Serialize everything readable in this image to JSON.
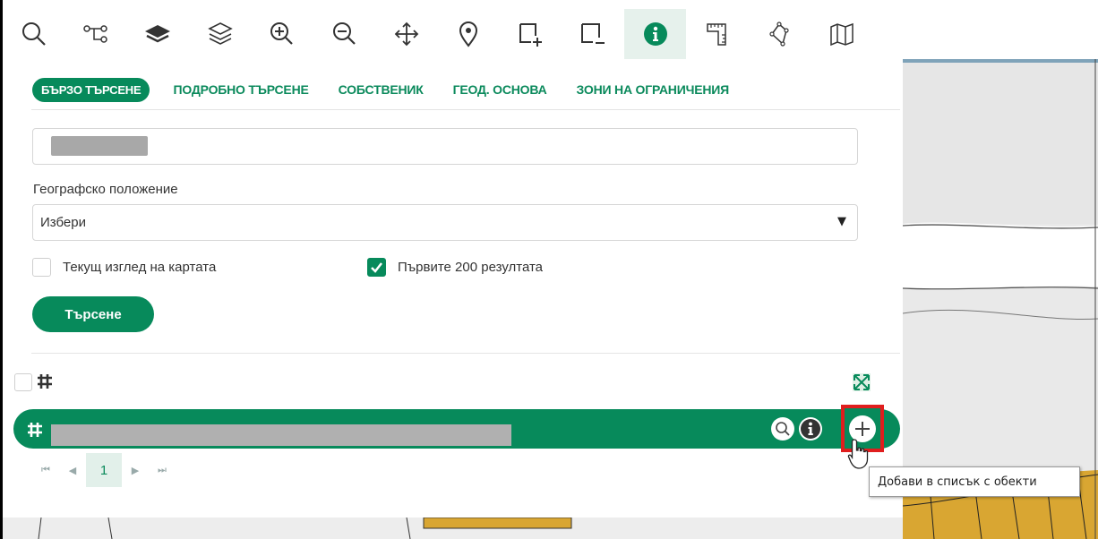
{
  "toolbar": {
    "tools": [
      {
        "icon": "search-icon"
      },
      {
        "icon": "route-icon"
      },
      {
        "icon": "layers-icon"
      },
      {
        "icon": "layers-outline-icon"
      },
      {
        "icon": "zoom-in-icon"
      },
      {
        "icon": "zoom-out-icon"
      },
      {
        "icon": "pan-icon"
      },
      {
        "icon": "location-pin-icon"
      },
      {
        "icon": "select-area-add-icon"
      },
      {
        "icon": "select-area-remove-icon"
      },
      {
        "icon": "info-icon",
        "active": true
      },
      {
        "icon": "measure-icon"
      },
      {
        "icon": "polygon-icon"
      },
      {
        "icon": "map-icon"
      }
    ]
  },
  "tabs": [
    {
      "label": "БЪРЗО ТЪРСЕНЕ",
      "active": true
    },
    {
      "label": "ПОДРОБНО ТЪРСЕНЕ"
    },
    {
      "label": "СОБСТВЕНИК"
    },
    {
      "label": "ГЕОД. ОСНОВА"
    },
    {
      "label": "ЗОНИ НА ОГРАНИЧЕНИЯ"
    }
  ],
  "form": {
    "geo_label": "Географско положение",
    "geo_value": "Избери",
    "current_view_label": "Текущ изглед на картата",
    "current_view_checked": false,
    "first200_label": "Първите 200 резултата",
    "first200_checked": true,
    "search_button": "Търсене"
  },
  "pager": {
    "current_page": "1"
  },
  "tooltip": "Добави в списък с обекти",
  "colors": {
    "brand_green": "#078a5b",
    "highlight_red": "#e01e1e"
  }
}
